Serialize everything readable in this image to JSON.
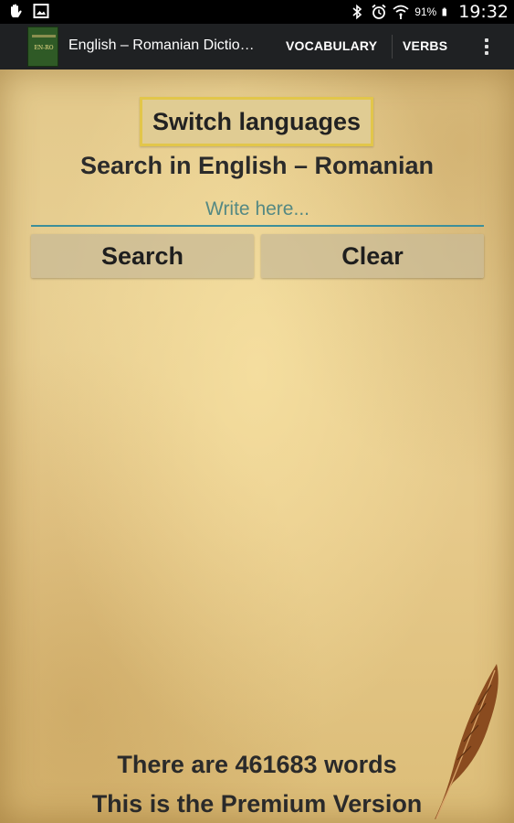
{
  "status_bar": {
    "battery": "91%",
    "time": "19:32",
    "icons": [
      "hand-icon",
      "image-icon",
      "bluetooth-icon",
      "alarm-icon",
      "wifi-icon",
      "battery-icon"
    ]
  },
  "action_bar": {
    "title": "English – Romanian Dictio…",
    "tabs": [
      {
        "label": "VOCABULARY"
      },
      {
        "label": "VERBS"
      }
    ],
    "app_icon_text": "EN-RO"
  },
  "main": {
    "switch_label": "Switch languages",
    "search_heading": "Search in English – Romanian",
    "input": {
      "value": "",
      "placeholder": "Write here..."
    },
    "search_button": "Search",
    "clear_button": "Clear",
    "word_count_text": "There are 461683 words",
    "version_text": "This is the Premium Version"
  },
  "colors": {
    "accent": "#3d8f9a",
    "switch_border": "#e2c64a",
    "parchment": "#e6c98a",
    "action_bar": "#1f2123"
  }
}
